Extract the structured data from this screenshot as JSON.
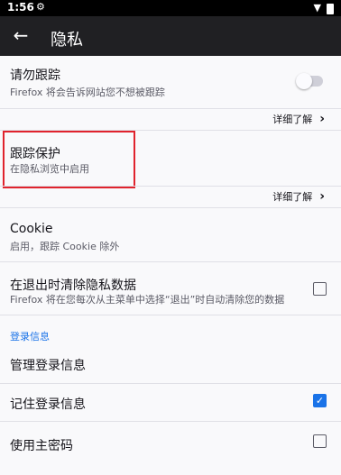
{
  "status_bar": {
    "time": "1:56"
  },
  "app_bar": {
    "title": "隐私"
  },
  "items": {
    "dnt": {
      "title": "请勿跟踪",
      "subtitle": "Firefox 将会告诉网站您不想被跟踪"
    },
    "learn_more_1": "详细了解",
    "tracking": {
      "title": "跟踪保护",
      "subtitle": "在隐私浏览中启用"
    },
    "learn_more_2": "详细了解",
    "cookie": {
      "title": "Cookie",
      "subtitle": "启用，跟踪 Cookie 除外"
    },
    "clear_data": {
      "title": "在退出时清除隐私数据",
      "subtitle": "Firefox 将在您每次从主菜单中选择“退出”时自动清除您的数据"
    }
  },
  "logins": {
    "header": "登录信息",
    "manage": "管理登录信息",
    "remember": "记住登录信息",
    "master_password": "使用主密码"
  },
  "state": {
    "dnt_enabled": false,
    "clear_on_exit": false,
    "remember_logins": true,
    "use_master_password": false
  },
  "colors": {
    "accent": "#1a73e8",
    "highlight": "#e0232d",
    "appbar": "#202023"
  }
}
